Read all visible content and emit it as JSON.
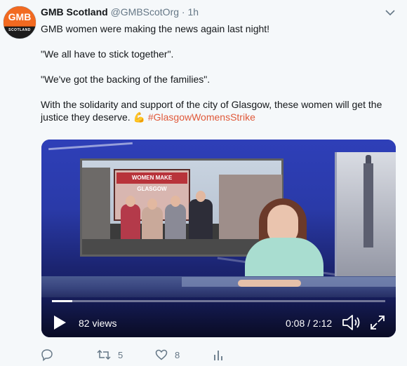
{
  "tweet": {
    "author_name": "GMB Scotland",
    "handle": "@GMBScotOrg",
    "separator": "·",
    "time": "1h",
    "avatar": {
      "top_text": "GMB",
      "bottom_text": "SCOTLAND"
    },
    "lines": [
      "GMB women were making the news again last night!",
      "\"We all have to stick together\".",
      "\"We've got the backing of the families\".",
      "With the solidarity and support of the city of Glasgow, these women will get the justice they deserve."
    ],
    "emoji": "💪",
    "hashtag": "#GlasgowWomensStrike",
    "hashtag_color": "#e0593a"
  },
  "video": {
    "screen_banner": "WOMEN MAKE GLASGOW",
    "views": "82 views",
    "time_readout": "0:08 / 2:12",
    "progress_fraction": 0.06
  },
  "actions": {
    "reply_icon": "reply-icon",
    "retweet_icon": "retweet-icon",
    "retweet_count": "5",
    "like_icon": "heart-icon",
    "like_count": "8",
    "analytics_icon": "analytics-icon"
  }
}
